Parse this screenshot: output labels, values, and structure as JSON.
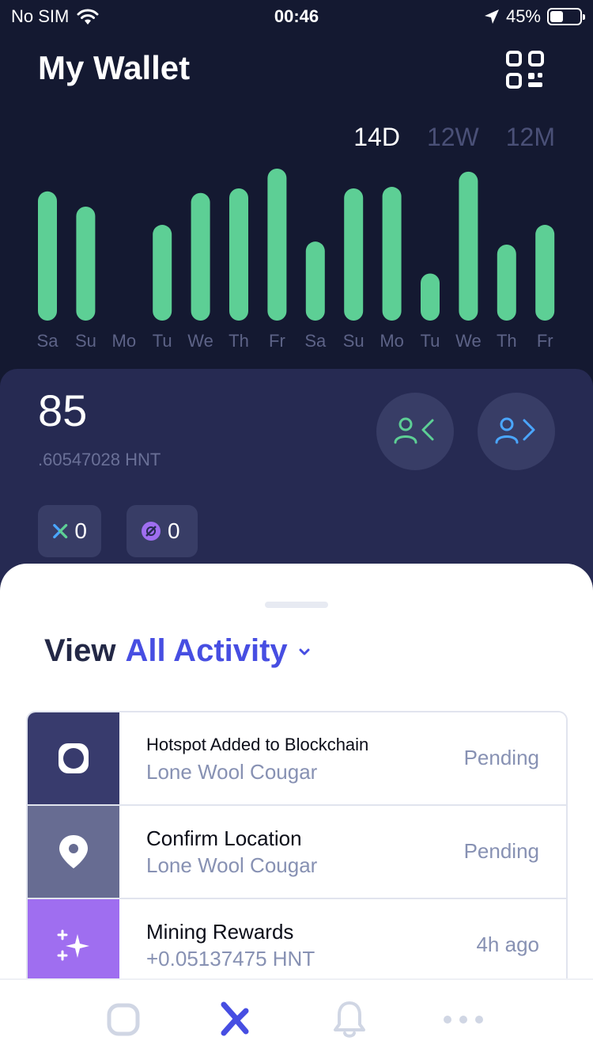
{
  "status_bar": {
    "carrier": "No SIM",
    "time": "00:46",
    "battery": "45%",
    "battery_level": 0.45
  },
  "header": {
    "title": "My Wallet"
  },
  "chart_ranges": [
    {
      "label": "14D",
      "active": true
    },
    {
      "label": "12W",
      "active": false
    },
    {
      "label": "12M",
      "active": false
    }
  ],
  "chart_data": {
    "type": "bar",
    "categories": [
      "Sa",
      "Su",
      "Mo",
      "Tu",
      "We",
      "Th",
      "Fr",
      "Sa",
      "Su",
      "Mo",
      "Tu",
      "We",
      "Th",
      "Fr"
    ],
    "values": [
      85,
      75,
      0,
      63,
      84,
      87,
      100,
      52,
      87,
      88,
      31,
      98,
      50,
      63
    ],
    "ylim": [
      0,
      100
    ],
    "colors": {
      "bar": "#5dcf95",
      "label": "#5d6387"
    }
  },
  "wallet": {
    "balance_int": "85",
    "balance_dec": ".60547028 HNT",
    "dc_balance": "0",
    "sec_balance": "0"
  },
  "activity": {
    "view_label": "View",
    "filter_label": "All Activity",
    "items": [
      {
        "title": "Hotspot Added to Blockchain",
        "subtitle": "Lone Wool Cougar",
        "status": "Pending",
        "icon": "hotspot-icon",
        "color": "#383b6d"
      },
      {
        "title": "Confirm Location",
        "subtitle": "Lone Wool Cougar",
        "status": "Pending",
        "icon": "location-pin-icon",
        "color": "#676c92"
      },
      {
        "title": "Mining Rewards",
        "subtitle": "+0.05137475 HNT",
        "status": "4h ago",
        "icon": "sparkle-icon",
        "color": "#9f6ef0"
      }
    ]
  },
  "colors": {
    "accent": "#474ee2",
    "background": "#141931",
    "wallet_panel": "#262a52"
  }
}
